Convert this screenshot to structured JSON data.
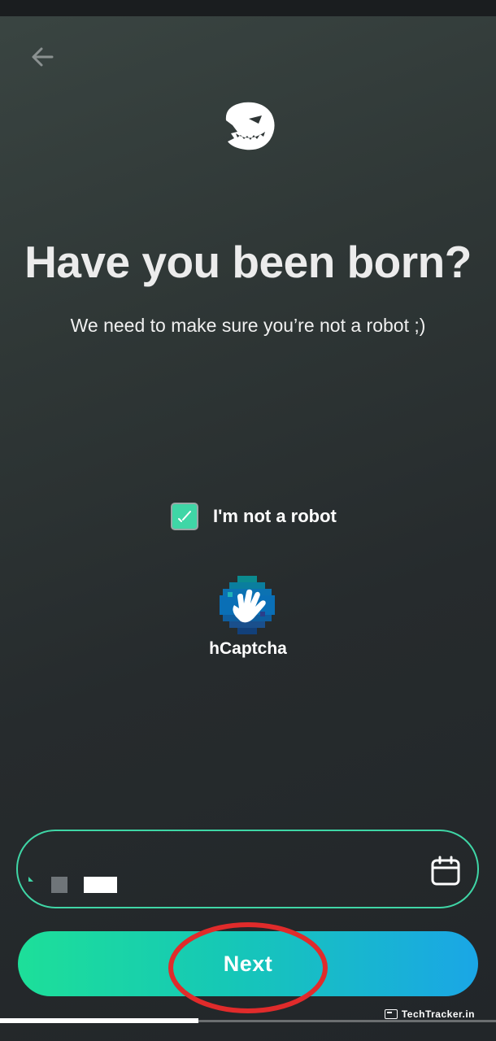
{
  "page": {
    "title": "Have you been born?",
    "subtitle": "We need to make sure you’re not a robot ;)"
  },
  "nav": {
    "back_icon": "arrow-left-icon"
  },
  "brand": {
    "logo_icon": "ghost-logo-icon"
  },
  "captcha": {
    "checkbox_label": "I'm not a robot",
    "checked": true,
    "provider_label": "hCaptcha",
    "provider_icon": "hcaptcha-hand-icon"
  },
  "date_field": {
    "icon": "calendar-icon"
  },
  "actions": {
    "next_label": "Next"
  },
  "watermark": {
    "text": "TechTracker.in"
  },
  "colors": {
    "accent": "#3fd6a6",
    "button_start": "#1ddf99",
    "button_end": "#1aa6e6",
    "annotation": "#e02b2b"
  }
}
